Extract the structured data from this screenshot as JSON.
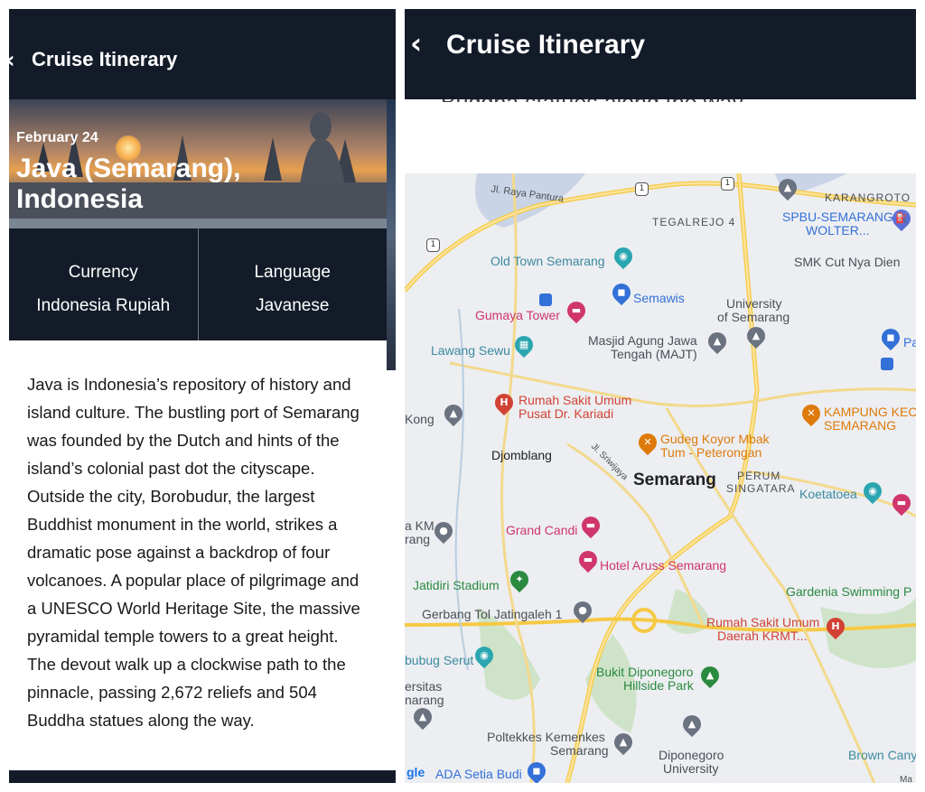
{
  "left": {
    "header_title": "Cruise Itinerary",
    "back_icon": "chevron-left-icon",
    "hero": {
      "date": "February 24",
      "place": "Java (Semarang), Indonesia"
    },
    "info": [
      {
        "label": "Currency",
        "value": "Indonesia Rupiah"
      },
      {
        "label": "Language",
        "value": "Javanese"
      }
    ],
    "description": "Java is Indonesia’s repository of history and island culture. The bustling port of Semarang was founded by the Dutch and hints of the island’s colonial past dot the cityscape. Outside the city, Borobudur, the largest Buddhist monument in the world, strikes a dramatic pose against a backdrop of four volcanoes. A popular place of pilgrimage and a UNESCO World Heritage Site, the massive pyramidal temple towers to a great height. The devout walk up a clockwise path to the pinnacle, passing 2,672 reliefs and 504 Buddha statues along the way."
  },
  "right": {
    "header_title": "Cruise Itinerary",
    "back_icon": "chevron-left-icon",
    "cut_text": "Buddha statues along the way.",
    "map": {
      "city": "Semarang",
      "labels": {
        "jl_raya_pantura": "Jl. Raya Pantura",
        "karangroto": "KARANGROTO",
        "tegalrejo": "TEGALREJO 4",
        "spbu": "SPBU-SEMARANG",
        "wolter": "WOLTER...",
        "old_town": "Old Town Semarang",
        "smk": "SMK Cut Nya Dien",
        "semawis": "Semawis",
        "university": "University",
        "of_semarang": "of Semarang",
        "gumaya": "Gumaya Tower",
        "masjid1": "Masjid Agung Jawa",
        "masjid2": "Tengah (MAJT)",
        "pa": "Pa",
        "lawang": "Lawang Sewu",
        "rsu1": "Rumah Sakit Umum",
        "rsu2": "Pusat Dr. Kariadi",
        "kong": "Kong",
        "kampung1": "KAMPUNG KEC",
        "kampung2": "SEMARANG",
        "gudeg1": "Gudeg Koyor Mbak",
        "gudeg2": "Tum - Peterongan",
        "djomblang": "Djomblang",
        "jl_sriwijaya": "Jl. Sriwijaya",
        "perum": "PERUM",
        "singatara": "SINGATARA",
        "koetatoea": "Koetatoea",
        "km": "a KM",
        "rang": "rang",
        "grand_candi": "Grand Candi",
        "hotel_aruss": "Hotel Aruss Semarang",
        "jatidiri": "Jatidiri Stadium",
        "gardenia": "Gardenia Swimming P",
        "gerbang": "Gerbang Tol Jatingaleh 1",
        "rsu_daerah1": "Rumah Sakit Umum",
        "rsu_daerah2": "Daerah KRMT...",
        "bubug": "bubug Serut",
        "bukit1": "Bukit Diponegoro",
        "bukit2": "Hillside Park",
        "ersitas": "ersitas",
        "narang": "narang",
        "poltekkes1": "Poltekkes Kemenkes",
        "poltekkes2": "Semarang",
        "dipo1": "Diponegoro",
        "dipo2": "University",
        "brown": "Brown Cany",
        "google": "gle",
        "ada": "ADA Setia Budi",
        "ma": "Ma"
      }
    }
  },
  "colors": {
    "header": "#131b29",
    "pink": "#d0366b",
    "teal": "#3c8aa0",
    "red": "#d24234",
    "orange": "#de7a0a",
    "green": "#2a8a40",
    "blue": "#3370d8"
  }
}
